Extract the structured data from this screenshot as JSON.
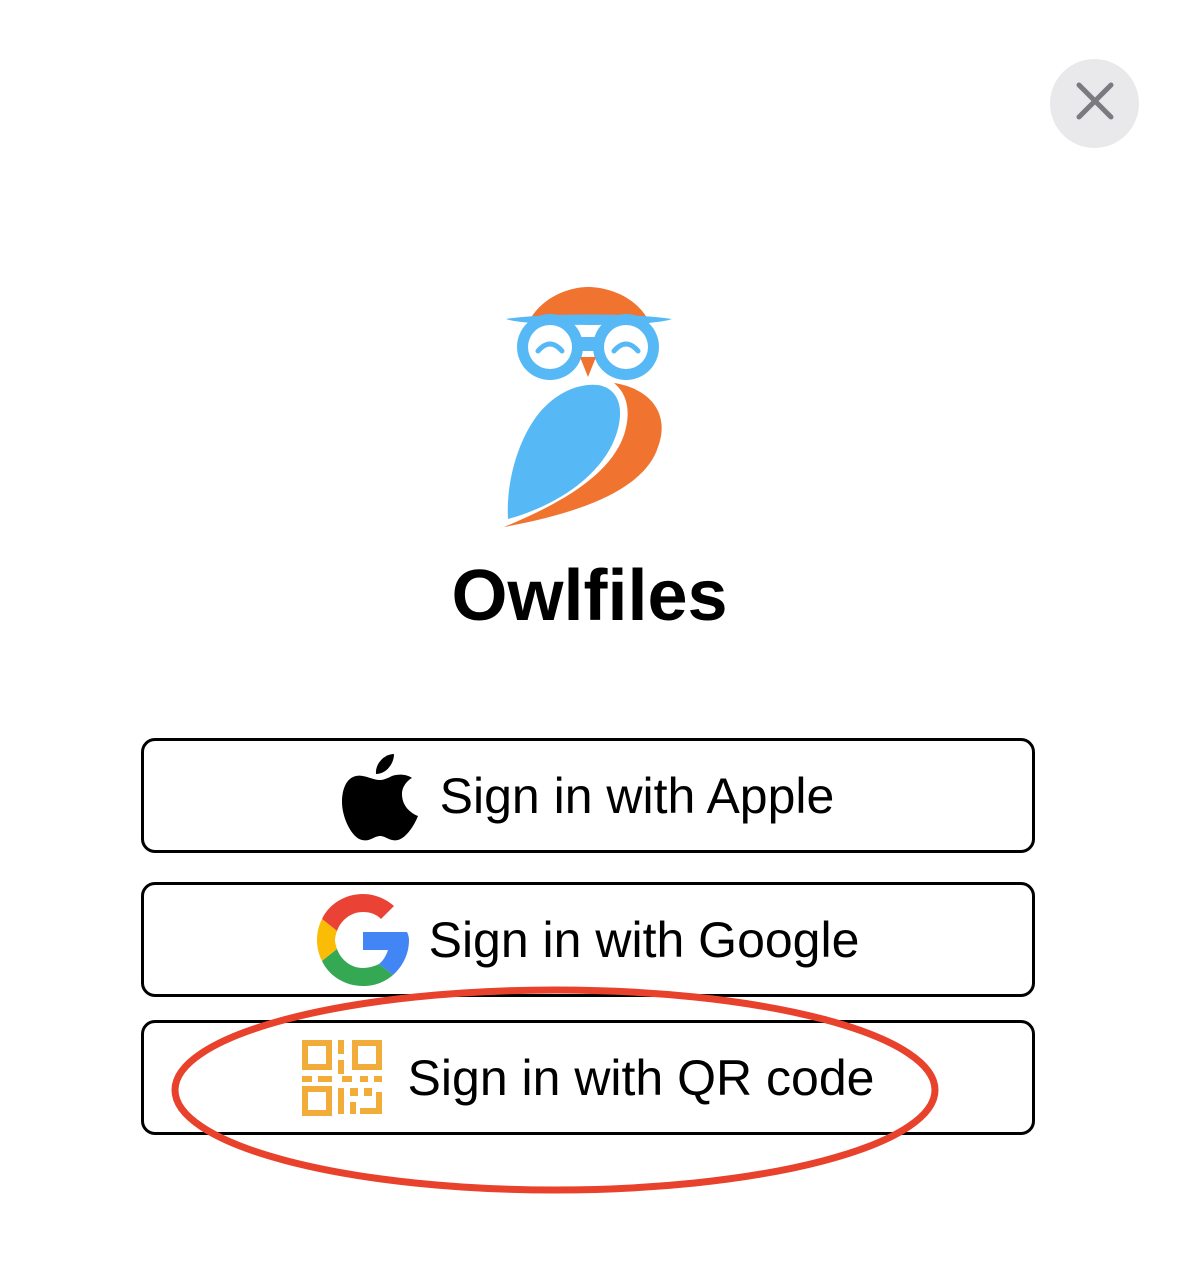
{
  "app": {
    "title": "Owlfiles"
  },
  "close_button": {
    "icon": "close-icon"
  },
  "signin_options": [
    {
      "label": "Sign in with Apple",
      "icon": "apple-icon"
    },
    {
      "label": "Sign in with Google",
      "icon": "google-icon"
    },
    {
      "label": "Sign in with QR code",
      "icon": "qr-code-icon"
    }
  ],
  "annotation": {
    "color": "#e8412c",
    "target": "Sign in with QR code"
  },
  "colors": {
    "owl_orange": "#f07430",
    "owl_blue": "#56b9f5",
    "qr_gold": "#f2ac3a",
    "close_bg": "#e9e9eb"
  }
}
